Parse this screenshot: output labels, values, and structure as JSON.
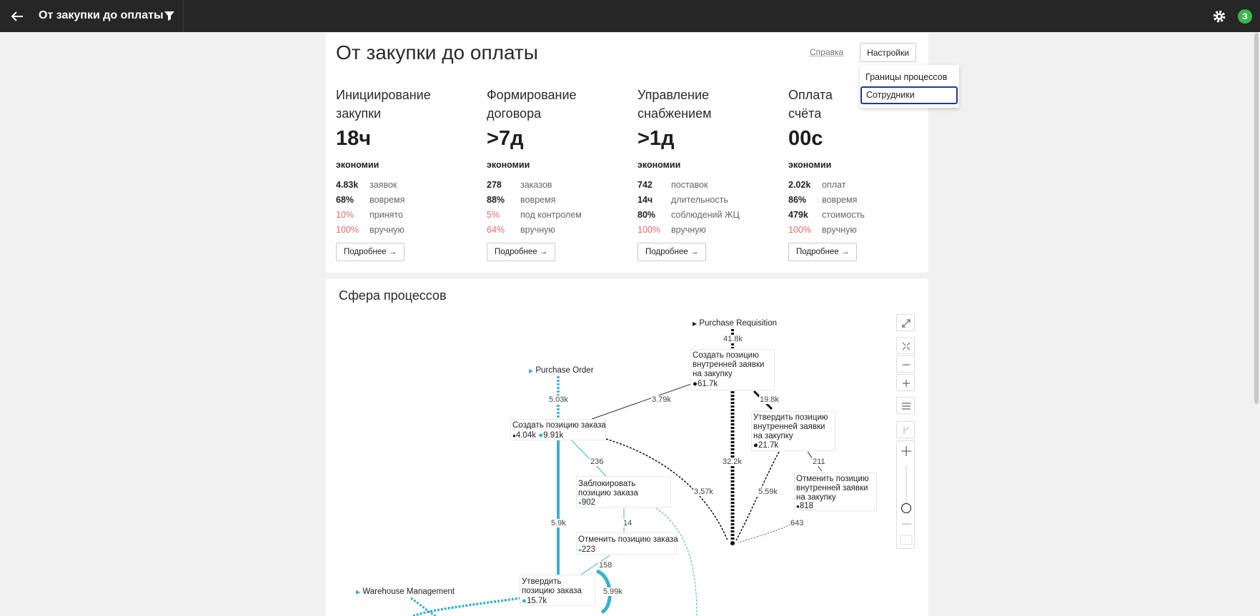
{
  "topbar": {
    "title": "От закупки до оплаты",
    "avatar": "З"
  },
  "header": {
    "title": "От закупки до оплаты",
    "help": "Справка",
    "settings": "Настройки"
  },
  "dropdown": {
    "items": [
      "Границы процессов",
      "Сотрудники"
    ]
  },
  "colors": {
    "accent": "#3ab1cc",
    "negative": "#e06a6a",
    "focus": "#23388f",
    "avatar": "#3db64a"
  },
  "kpis": [
    {
      "name": "Инициирование закупки",
      "value": "18ч",
      "sub": "экономии",
      "rows": [
        {
          "v": "4.83k",
          "l": "заявок"
        },
        {
          "v": "68%",
          "l": "вовремя"
        },
        {
          "v": "10%",
          "l": "принято"
        },
        {
          "v": "100%",
          "l": "вручную"
        }
      ],
      "more": "Подробнее"
    },
    {
      "name": "Формирование договора",
      "value": ">7д",
      "sub": "экономии",
      "rows": [
        {
          "v": "278",
          "l": "заказов"
        },
        {
          "v": "88%",
          "l": "вовремя"
        },
        {
          "v": "5%",
          "l": "под контролем"
        },
        {
          "v": "64%",
          "l": "вручную"
        }
      ],
      "more": "Подробнее"
    },
    {
      "name": "Управление снабжением",
      "value": ">1д",
      "sub": "экономии",
      "rows": [
        {
          "v": "742",
          "l": "поставок"
        },
        {
          "v": "14ч",
          "l": "длительность"
        },
        {
          "v": "80%",
          "l": "соблюдений ЖЦ"
        },
        {
          "v": "100%",
          "l": "вручную"
        }
      ],
      "more": "Подробнее"
    },
    {
      "name": "Оплата счёта",
      "value": "00с",
      "sub": "экономии",
      "rows": [
        {
          "v": "2.02k",
          "l": "оплат"
        },
        {
          "v": "86%",
          "l": "вовремя"
        },
        {
          "v": "479k",
          "l": "стоимость"
        },
        {
          "v": "100%",
          "l": "вручную"
        }
      ],
      "more": "Подробнее"
    }
  ],
  "sphere": {
    "title": "Сфера процессов",
    "nodes": {
      "pr_start": "Purchase Requisition",
      "po_start": "Purchase Order",
      "wm_start": "Warehouse Management",
      "create_req": {
        "name": "Создать позицию внутренней заявки на закупку",
        "count": "61.7k"
      },
      "approve_req": {
        "name": "Утвердить позицию внутренней заявки на закупку",
        "count": "21.7k"
      },
      "cancel_req": {
        "name": "Отменить позицию внутренней заявки на закупку",
        "count": "818"
      },
      "create_order": {
        "name": "Создать позицию заказа",
        "count_a": "4.04k",
        "count_b": "9.91k"
      },
      "block_order": {
        "name": "Заблокировать позицию заказа",
        "count": "902"
      },
      "cancel_order": {
        "name": "Отменить позицию заказа",
        "count": "223"
      },
      "approve_order": {
        "name": "Утвердить позицию заказа",
        "count": "15.7k"
      }
    },
    "edges": [
      "41.8k",
      "5.03k",
      "3.79k",
      "19.8k",
      "236",
      "32.2k",
      "211",
      "3.57k",
      "5.59k",
      "5.9k",
      "14",
      "643",
      "158",
      "5.99k"
    ]
  }
}
